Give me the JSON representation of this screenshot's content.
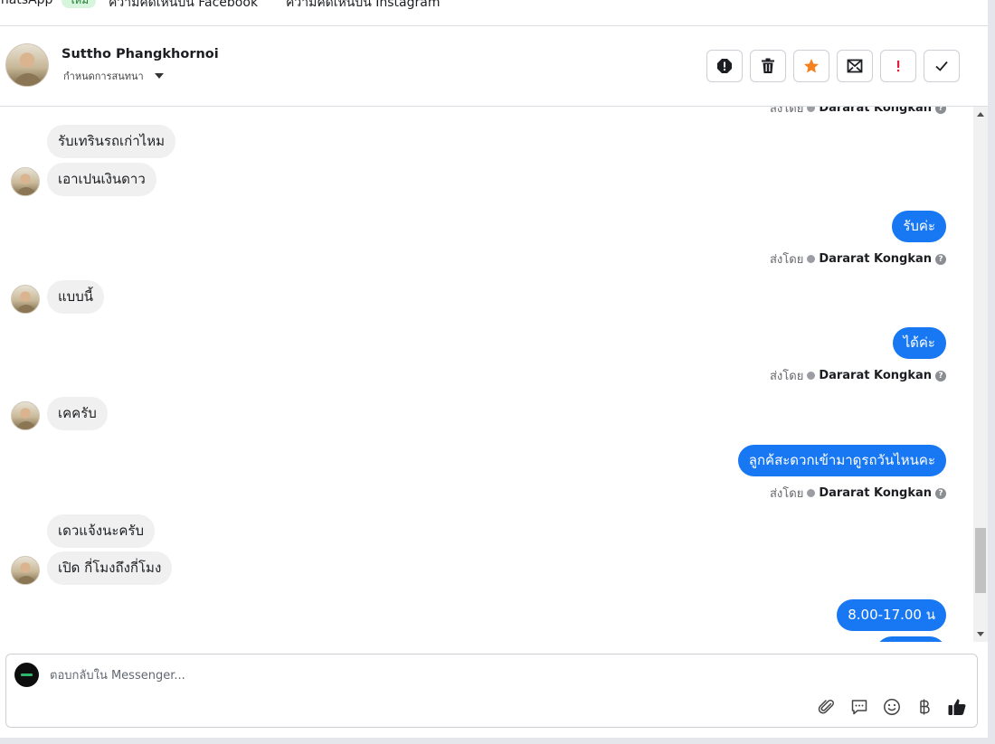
{
  "top_tabs": [
    {
      "label": "WhatsApp",
      "badge": "ใหม่"
    },
    {
      "label": "ความคิดเห็นบน Facebook"
    },
    {
      "label": "ความคิดเห็นบน Instagram"
    }
  ],
  "header": {
    "contact_name": "Suttho Phangkhornoi",
    "assign_label": "กำหนดการสนทนา",
    "actions": [
      "alert-icon",
      "trash-icon",
      "star-icon",
      "mark-unread-icon",
      "exclamation-icon",
      "check-icon"
    ]
  },
  "messages": {
    "clipped_top_sent_by": {
      "prefix": "ส่งโดย",
      "agent": "Dararat Kongkan"
    },
    "items": [
      {
        "dir": "in",
        "text": "รับเทรินรถเก่าไหม"
      },
      {
        "dir": "in",
        "text": "เอาเปนเงินดาว"
      },
      {
        "dir": "out",
        "text": "รับค่ะ",
        "sent_by_prefix": "ส่งโดย",
        "agent": "Dararat Kongkan"
      },
      {
        "dir": "in",
        "text": "แบบนี้"
      },
      {
        "dir": "out",
        "text": "ได้ค่ะ",
        "sent_by_prefix": "ส่งโดย",
        "agent": "Dararat Kongkan"
      },
      {
        "dir": "in",
        "text": "เคครับ"
      },
      {
        "dir": "out",
        "text": "ลูกค้สะดวกเข้ามาดูรถวันไหนคะ",
        "sent_by_prefix": "ส่งโดย",
        "agent": "Dararat Kongkan"
      },
      {
        "dir": "in",
        "text": "เดวแจ้งนะครับ"
      },
      {
        "dir": "in",
        "text": "เปิด กี่โมงถึงกี่โมง"
      },
      {
        "dir": "out",
        "text": "8.00-17.00 น"
      }
    ]
  },
  "composer": {
    "placeholder": "ตอบกลับใน Messenger...",
    "tools": [
      "paperclip-icon",
      "saved-reply-icon",
      "emoji-icon",
      "baht-icon",
      "thumbs-up-icon"
    ]
  },
  "colors": {
    "outgoing_bubble": "#1877f2",
    "incoming_bubble": "#f0f0f0",
    "star": "#f5821f",
    "danger": "#e41e3f"
  }
}
